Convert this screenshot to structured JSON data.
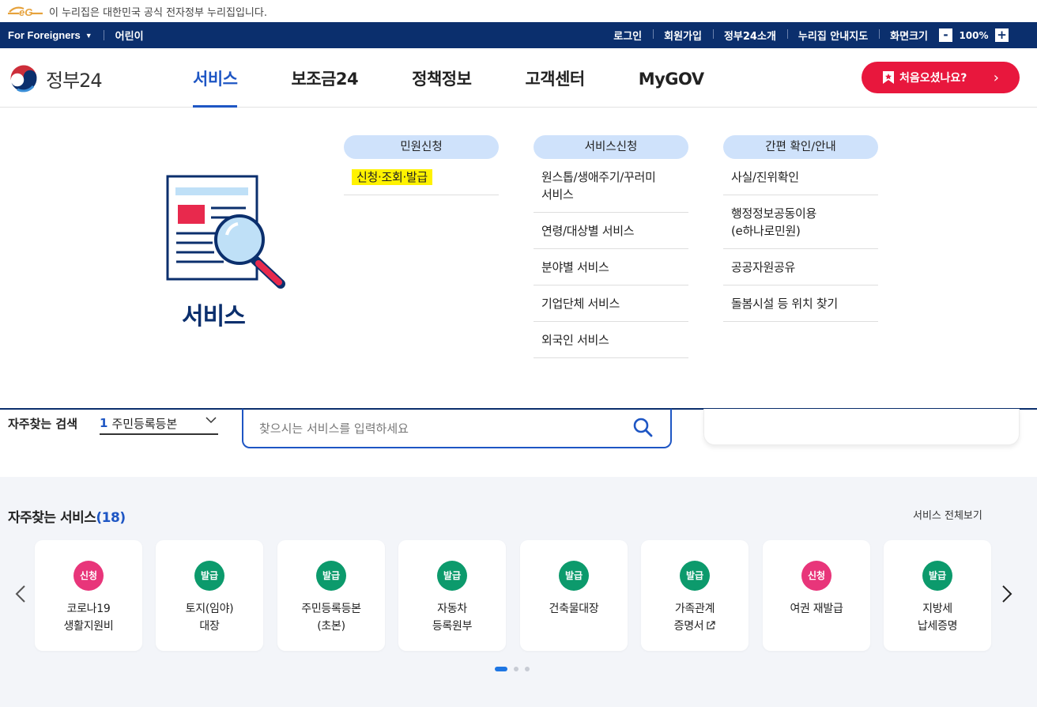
{
  "banner": {
    "text": "이 누리집은 대한민국 공식 전자정부 누리집입니다."
  },
  "util": {
    "foreigners": "For Foreigners",
    "kids": "어린이",
    "login": "로그인",
    "join": "회원가입",
    "about": "정부24소개",
    "sitemap": "누리집 안내지도",
    "screen_size": "화면크기",
    "zoom_minus": "-",
    "zoom_value": "100%",
    "zoom_plus": "+"
  },
  "header": {
    "logo_text": "정부24",
    "nav": [
      "서비스",
      "보조금24",
      "정책정보",
      "고객센터",
      "MyGOV"
    ],
    "first_visit": "처음오셨나요?"
  },
  "mega": {
    "title": "서비스",
    "col1": {
      "head": "민원신청",
      "items": [
        "신청·조회·발급"
      ]
    },
    "col2": {
      "head": "서비스신청",
      "items": [
        "원스톱/생애주기/꾸러미\n서비스",
        "연령/대상별 서비스",
        "분야별 서비스",
        "기업단체 서비스",
        "외국인 서비스"
      ]
    },
    "col3": {
      "head": "간편 확인/안내",
      "items": [
        "사실/진위확인",
        "행정정보공동이용\n(e하나로민원)",
        "공공자원공유",
        "돌봄시설 등 위치 찾기"
      ]
    }
  },
  "search": {
    "freq_label": "자주찾는 검색",
    "freq_num": "1",
    "freq_value": "주민등록등본",
    "placeholder": "찾으시는 서비스를 입력하세요"
  },
  "freq": {
    "title": "자주찾는 서비스",
    "count": "(18)",
    "view_all": "서비스 전체보기",
    "cards": [
      {
        "badge": "신청",
        "type": "apply",
        "title": "코로나19\n생활지원비"
      },
      {
        "badge": "발급",
        "type": "issue",
        "title": "토지(임야)\n대장"
      },
      {
        "badge": "발급",
        "type": "issue",
        "title": "주민등록등본\n(초본)"
      },
      {
        "badge": "발급",
        "type": "issue",
        "title": "자동차\n등록원부"
      },
      {
        "badge": "발급",
        "type": "issue",
        "title": "건축물대장"
      },
      {
        "badge": "발급",
        "type": "issue",
        "title": "가족관계\n증명서"
      },
      {
        "badge": "신청",
        "type": "apply",
        "title": "여권 재발급"
      },
      {
        "badge": "발급",
        "type": "issue",
        "title": "지방세\n납세증명"
      }
    ]
  },
  "colors": {
    "navy": "#0b2f6d",
    "accent": "#1e56c4",
    "red": "#e8173d",
    "apply": "#e8357a",
    "issue": "#0c9a6c"
  }
}
